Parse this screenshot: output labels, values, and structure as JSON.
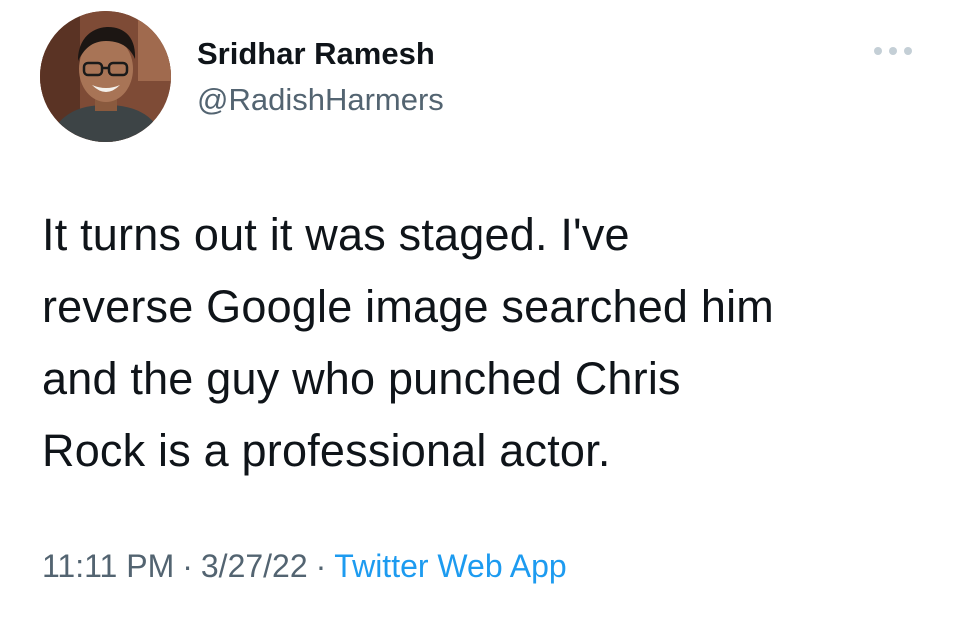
{
  "author": {
    "display_name": "Sridhar Ramesh",
    "handle": "@RadishHarmers"
  },
  "tweet": {
    "text_lines": [
      "It turns out it was staged. I've",
      "reverse Google image searched him",
      "and the guy who punched Chris",
      "Rock is a professional actor."
    ]
  },
  "meta": {
    "time": "11:11 PM",
    "date": "3/27/22",
    "separator": "·",
    "source": "Twitter Web App"
  },
  "icons": {
    "more": "more-horizontal-icon"
  },
  "colors": {
    "text_primary": "#0f1419",
    "text_secondary": "#536471",
    "link": "#1d9bf0",
    "icon_gray": "#c4cfd6"
  }
}
